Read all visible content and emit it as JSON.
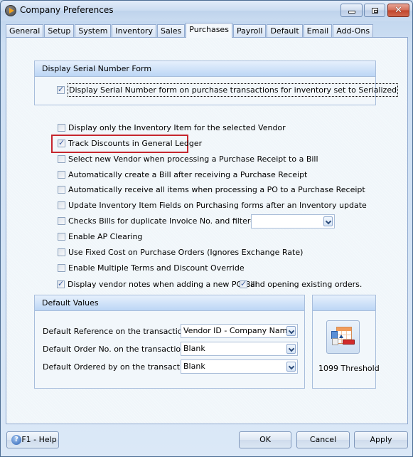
{
  "window": {
    "title": "Company Preferences",
    "controls": {
      "minimize": "minimize",
      "maximize": "maximize",
      "close": "✕"
    }
  },
  "tabs": [
    {
      "label": "General",
      "active": false
    },
    {
      "label": "Setup",
      "active": false
    },
    {
      "label": "System",
      "active": false
    },
    {
      "label": "Inventory",
      "active": false
    },
    {
      "label": "Sales",
      "active": false
    },
    {
      "label": "Purchases",
      "active": true
    },
    {
      "label": "Payroll",
      "active": false
    },
    {
      "label": "Default",
      "active": false
    },
    {
      "label": "Email",
      "active": false
    },
    {
      "label": "Add-Ons",
      "active": false
    }
  ],
  "serial_group": {
    "title": "Display Serial Number Form",
    "option": {
      "label": "Display Serial Number form on purchase transactions for inventory set to Serialized",
      "checked": true
    }
  },
  "options": [
    {
      "label": "Display only the Inventory Item for the selected Vendor",
      "checked": false
    },
    {
      "label": "Track Discounts in General Ledger",
      "checked": true,
      "highlighted": true
    },
    {
      "label": "Select new Vendor when processing a Purchase Receipt to a Bill",
      "checked": false
    },
    {
      "label": "Automatically create a Bill after receiving a Purchase Receipt",
      "checked": false
    },
    {
      "label": "Automatically receive all items when processing a PO to a Purchase Receipt",
      "checked": false
    },
    {
      "label": "Update Inventory Item Fields on Purchasing forms after an Inventory update",
      "checked": false
    },
    {
      "label": "Checks Bills for duplicate Invoice No. and filtered by:",
      "checked": false
    },
    {
      "label": "Enable AP Clearing",
      "checked": false
    },
    {
      "label": "Use Fixed Cost on Purchase Orders (Ignores Exchange Rate)",
      "checked": false
    },
    {
      "label": "Enable Multiple Terms and Discount Override",
      "checked": false
    }
  ],
  "duplicate_filter": {
    "value": ""
  },
  "vendor_notes": {
    "label": "Display vendor notes when adding a new PO\\Bill",
    "checked": true,
    "existing_label": "and opening existing orders.",
    "existing_checked": true
  },
  "default_values": {
    "title": "Default Values",
    "rows": [
      {
        "label": "Default Reference on the transactions",
        "value": "Vendor ID - Company Name"
      },
      {
        "label": "Default Order No. on the transactions",
        "value": "Blank"
      },
      {
        "label": "Default Ordered by on the transactions",
        "value": "Blank"
      }
    ]
  },
  "threshold": {
    "label": "1099 Threshold",
    "icon": "spreadsheet-threshold-icon"
  },
  "footer": {
    "help_label": "F1 - Help",
    "ok_label": "OK",
    "cancel_label": "Cancel",
    "apply_label": "Apply"
  }
}
